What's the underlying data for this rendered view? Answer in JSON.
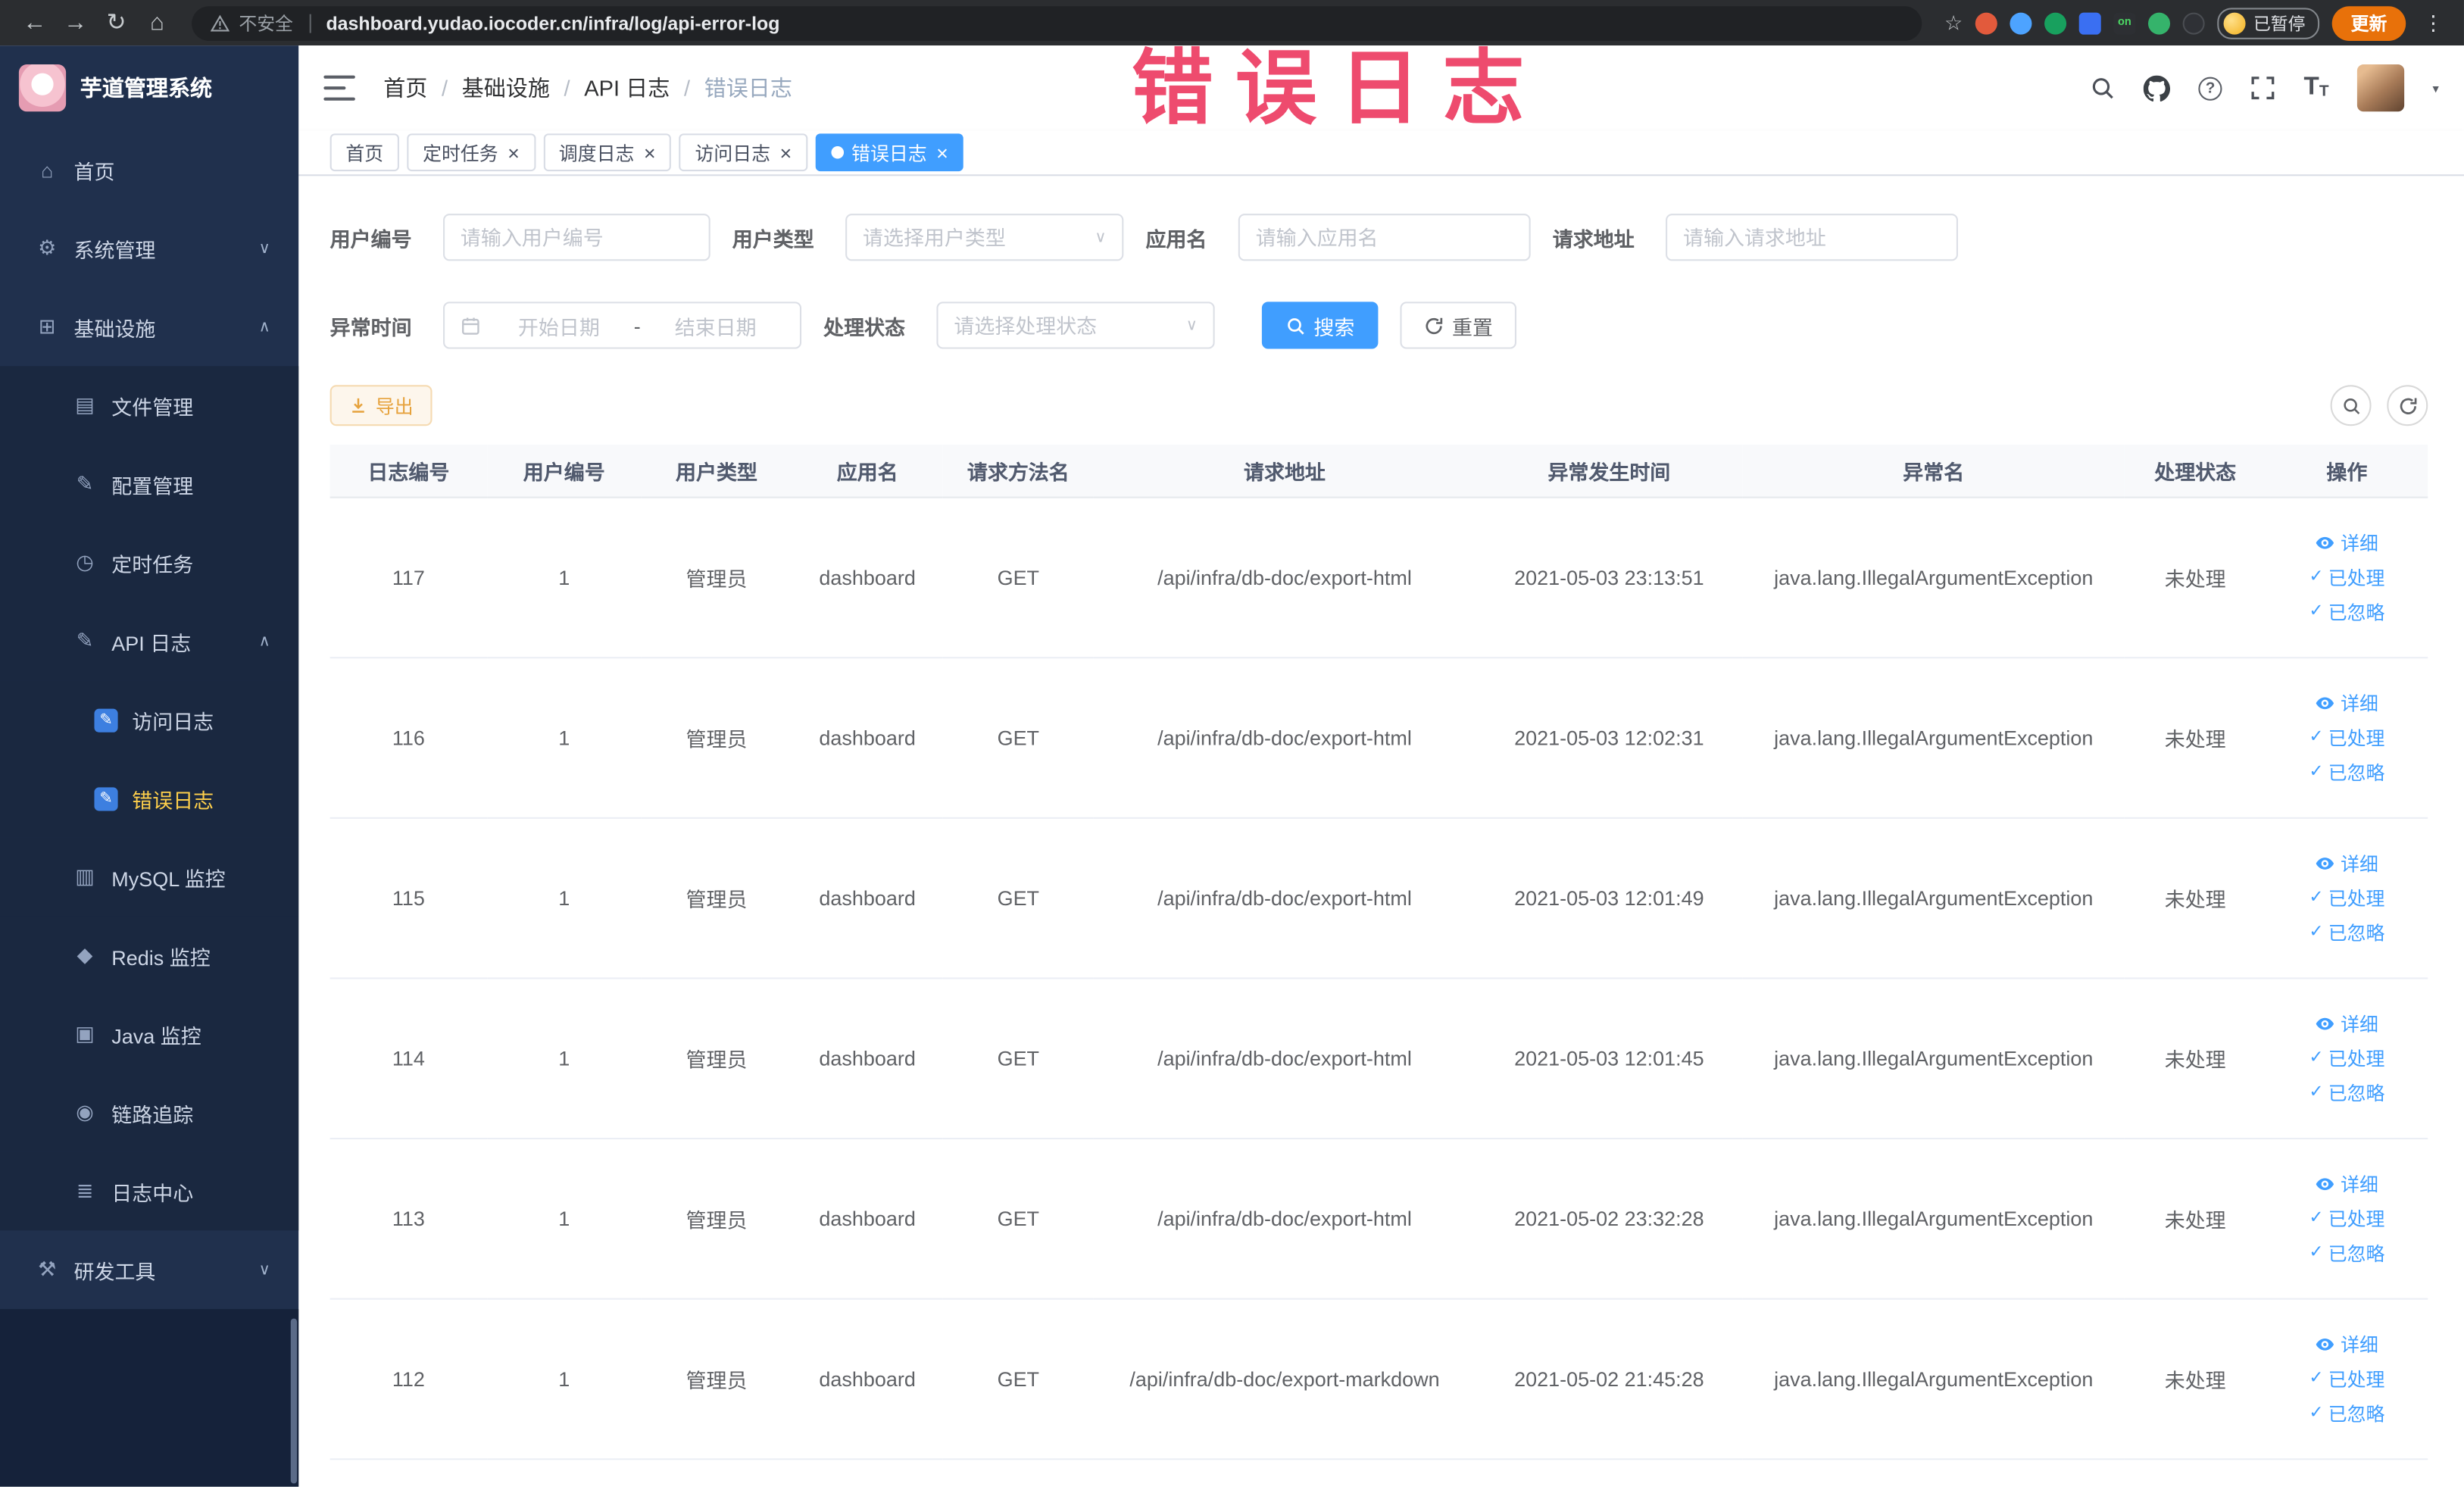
{
  "browser": {
    "security_label": "不安全",
    "url": "dashboard.yudao.iocoder.cn/infra/log/api-error-log",
    "on_badge": "on",
    "paused_badge": "已暂停",
    "update_button": "更新"
  },
  "icons": {
    "back": "←",
    "forward": "→",
    "reload": "↻",
    "home": "⌂",
    "star": "☆",
    "kebab": "⋮",
    "chevron_up": "∧",
    "chevron_down": "∨",
    "select_chevron": "∨",
    "caret_down": "▾",
    "check": "✓",
    "close": "×",
    "help": "?",
    "font_large": "T",
    "font_small": "T"
  },
  "annotation": {
    "text": "错误日志"
  },
  "sidebar": {
    "logo_title": "芋道管理系统",
    "items": [
      {
        "key": "home",
        "label": "首页",
        "level": 1,
        "icon": "home-icon",
        "glyph": "⌂"
      },
      {
        "key": "system-management",
        "label": "系统管理",
        "level": 1,
        "icon": "gear-icon",
        "glyph": "⚙",
        "chevron": "down"
      },
      {
        "key": "infrastructure",
        "label": "基础设施",
        "level": 1,
        "icon": "grid-icon",
        "glyph": "⊞",
        "chevron": "up"
      },
      {
        "key": "file-management",
        "label": "文件管理",
        "level": 2,
        "icon": "file-icon",
        "glyph": "▤"
      },
      {
        "key": "config-management",
        "label": "配置管理",
        "level": 2,
        "icon": "edit-icon",
        "glyph": "✎"
      },
      {
        "key": "scheduled-tasks",
        "label": "定时任务",
        "level": 2,
        "icon": "timer-icon",
        "glyph": "◷"
      },
      {
        "key": "api-log",
        "label": "API 日志",
        "level": 2,
        "icon": "log-icon",
        "glyph": "✎",
        "chevron": "up"
      },
      {
        "key": "access-log",
        "label": "访问日志",
        "level": 3,
        "icon": "edit-square-icon",
        "glyph": "✎"
      },
      {
        "key": "error-log",
        "label": "错误日志",
        "level": 3,
        "icon": "edit-square-icon",
        "glyph": "✎",
        "active": true
      },
      {
        "key": "mysql-monitor",
        "label": "MySQL 监控",
        "level": 2,
        "icon": "database-icon",
        "glyph": "▥"
      },
      {
        "key": "redis-monitor",
        "label": "Redis 监控",
        "level": 2,
        "icon": "redis-icon",
        "glyph": "◆"
      },
      {
        "key": "java-monitor",
        "label": "Java 监控",
        "level": 2,
        "icon": "java-icon",
        "glyph": "▣"
      },
      {
        "key": "trace",
        "label": "链路追踪",
        "level": 2,
        "icon": "eye-icon",
        "glyph": "◉"
      },
      {
        "key": "log-center",
        "label": "日志中心",
        "level": 2,
        "icon": "log-center-icon",
        "glyph": "≣"
      },
      {
        "key": "dev-tools",
        "label": "研发工具",
        "level": 1,
        "icon": "tools-icon",
        "glyph": "⚒",
        "chevron": "down"
      }
    ]
  },
  "breadcrumb": {
    "separator": "/",
    "items": [
      "首页",
      "基础设施",
      "API 日志",
      "错误日志"
    ]
  },
  "tabs": [
    {
      "key": "home",
      "label": "首页",
      "closable": false,
      "active": false
    },
    {
      "key": "scheduled-tasks",
      "label": "定时任务",
      "closable": true,
      "active": false
    },
    {
      "key": "schedule-log",
      "label": "调度日志",
      "closable": true,
      "active": false
    },
    {
      "key": "access-log",
      "label": "访问日志",
      "closable": true,
      "active": false
    },
    {
      "key": "error-log",
      "label": "错误日志",
      "closable": true,
      "active": true
    }
  ],
  "filters": {
    "user_id_label": "用户编号",
    "user_id_placeholder": "请输入用户编号",
    "user_type_label": "用户类型",
    "user_type_placeholder": "请选择用户类型",
    "app_name_label": "应用名",
    "app_name_placeholder": "请输入应用名",
    "request_url_label": "请求地址",
    "request_url_placeholder": "请输入请求地址",
    "exception_time_label": "异常时间",
    "date_start_placeholder": "开始日期",
    "date_separator": "-",
    "date_end_placeholder": "结束日期",
    "process_status_label": "处理状态",
    "process_status_placeholder": "请选择处理状态",
    "search_button": "搜索",
    "reset_button": "重置"
  },
  "toolbar": {
    "export_button": "导出"
  },
  "table": {
    "columns": [
      "日志编号",
      "用户编号",
      "用户类型",
      "应用名",
      "请求方法名",
      "请求地址",
      "异常发生时间",
      "异常名",
      "处理状态",
      "操作"
    ],
    "row_actions": [
      {
        "key": "detail",
        "label": "详细",
        "icon": "eye-icon"
      },
      {
        "key": "processed",
        "label": "已处理",
        "icon": "check-icon"
      },
      {
        "key": "ignored",
        "label": "已忽略",
        "icon": "check-icon"
      }
    ],
    "rows": [
      {
        "id": "117",
        "user_id": "1",
        "user_type": "管理员",
        "app_name": "dashboard",
        "method": "GET",
        "url": "/api/infra/db-doc/export-html",
        "time": "2021-05-03 23:13:51",
        "exception": "java.lang.IllegalArgumentException",
        "status": "未处理"
      },
      {
        "id": "116",
        "user_id": "1",
        "user_type": "管理员",
        "app_name": "dashboard",
        "method": "GET",
        "url": "/api/infra/db-doc/export-html",
        "time": "2021-05-03 12:02:31",
        "exception": "java.lang.IllegalArgumentException",
        "status": "未处理"
      },
      {
        "id": "115",
        "user_id": "1",
        "user_type": "管理员",
        "app_name": "dashboard",
        "method": "GET",
        "url": "/api/infra/db-doc/export-html",
        "time": "2021-05-03 12:01:49",
        "exception": "java.lang.IllegalArgumentException",
        "status": "未处理"
      },
      {
        "id": "114",
        "user_id": "1",
        "user_type": "管理员",
        "app_name": "dashboard",
        "method": "GET",
        "url": "/api/infra/db-doc/export-html",
        "time": "2021-05-03 12:01:45",
        "exception": "java.lang.IllegalArgumentException",
        "status": "未处理"
      },
      {
        "id": "113",
        "user_id": "1",
        "user_type": "管理员",
        "app_name": "dashboard",
        "method": "GET",
        "url": "/api/infra/db-doc/export-html",
        "time": "2021-05-02 23:32:28",
        "exception": "java.lang.IllegalArgumentException",
        "status": "未处理"
      },
      {
        "id": "112",
        "user_id": "1",
        "user_type": "管理员",
        "app_name": "dashboard",
        "method": "GET",
        "url": "/api/infra/db-doc/export-markdown",
        "time": "2021-05-02 21:45:28",
        "exception": "java.lang.IllegalArgumentException",
        "status": "未处理"
      }
    ]
  },
  "colors": {
    "accent_blue": "#409eff",
    "active_menu_gold": "#ffd04b",
    "warning_orange": "#e6a23c",
    "annotation_pink": "#ee4b6e",
    "sidebar_bg": "#20304d",
    "chrome_bg": "#2b2d30"
  }
}
